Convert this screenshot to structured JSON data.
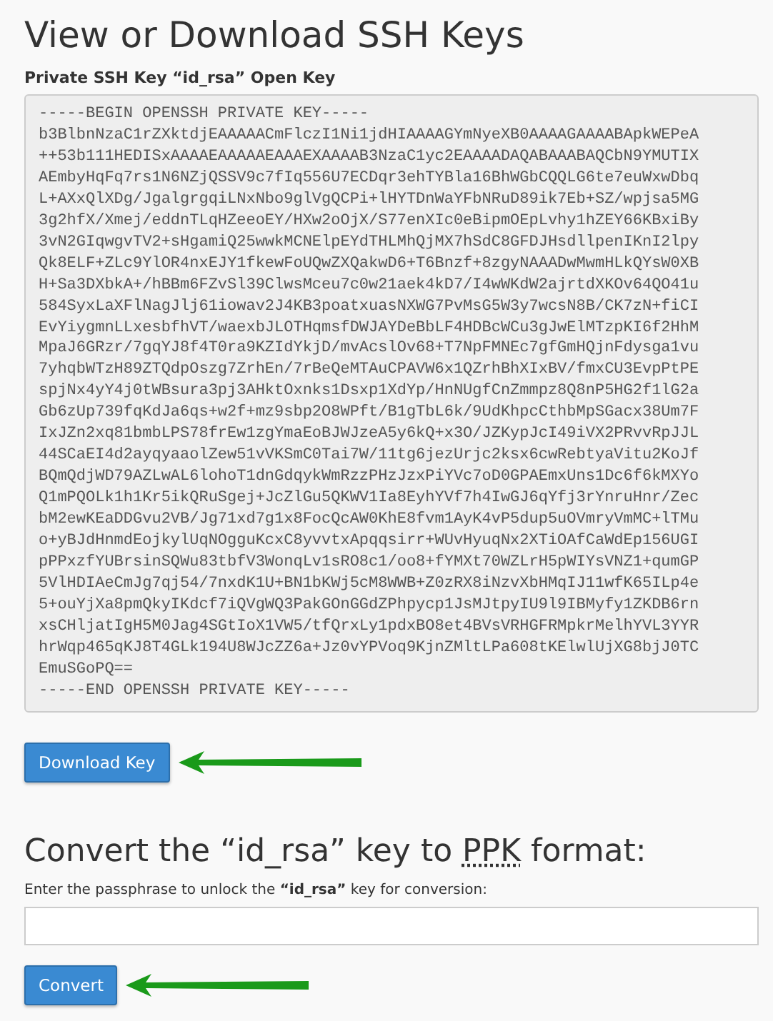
{
  "title": "View or Download SSH Keys",
  "key_label": "Private SSH Key “id_rsa” Open Key",
  "key_text": "-----BEGIN OPENSSH PRIVATE KEY-----\nb3BlbnNzaC1rZXktdjEAAAAACmFlczI1Ni1jdHIAAAAGYmNyeXB0AAAAGAAAABApkWEPeA\n++53b111HEDISxAAAAEAAAAAEAAAEXAAAAB3NzaC1yc2EAAAADAQABAAABAQCbN9YMUTIX\nAEmbyHqFq7rs1N6NZjQSSV9c7fIq556U7ECDqr3ehTYBla16BhWGbCQQLG6te7euWxwDbq\nL+AXxQlXDg/JgalgrgqiLNxNbo9glVgQCPi+lHYTDnWaYFbNRuD89ik7Eb+SZ/wpjsa5MG\n3g2hfX/Xmej/eddnTLqHZeeoEY/HXw2oOjX/S77enXIc0eBipmOEpLvhy1hZEY66KBxiBy\n3vN2GIqwgvTV2+sHgamiQ25wwkMCNElpEYdTHLMhQjMX7hSdC8GFDJHsdllpenIKnI2lpy\nQk8ELF+ZLc9YlOR4nxEJY1fkewFoUQwZXQakwD6+T6Bnzf+8zgyNAAADwMwmHLkQYsW0XB\nH+Sa3DXbkA+/hBBm6FZvSl39ClwsMceu7c0w21aek4kD7/I4wWKdW2ajrtdXKOv64QO41u\n584SyxLaXFlNagJlj61iowav2J4KB3poatxuasNXWG7PvMsG5W3y7wcsN8B/CK7zN+fiCI\nEvYiygmnLLxesbfhVT/waexbJLOTHqmsfDWJAYDeBbLF4HDBcWCu3gJwElMTzpKI6f2HhM\nMpaJ6GRzr/7gqYJ8f4T0ra9KZIdYkjD/mvAcslOv68+T7NpFMNEc7gfGmHQjnFdysga1vu\n7yhqbWTzH89ZTQdpOszg7ZrhEn/7rBeQeMTAuCPAVW6x1QZrhBhXIxBV/fmxCU3EvpPtPE\nspjNx4yY4j0tWBsura3pj3AHktOxnks1Dsxp1XdYp/HnNUgfCnZmmpz8Q8nP5HG2f1lG2a\nGb6zUp739fqKdJa6qs+w2f+mz9sbp2O8WPft/B1gTbL6k/9UdKhpcCthbMpSGacx38Um7F\nIxJZn2xq81bmbLPS78frEw1zgYmaEoBJWJzeA5y6kQ+x3O/JZKypJcI49iVX2PRvvRpJJL\n44SCaEI4d2ayqyaaolZew51vVKSmC0Tai7W/11tg6jezUrjc2ksx6cwRebtyaVitu2KoJf\nBQmQdjWD79AZLwAL6lohoT1dnGdqykWmRzzPHzJzxPiYVc7oD0GPAEmxUns1Dc6f6kMXYo\nQ1mPQOLk1h1Kr5ikQRuSgej+JcZlGu5QKWV1Ia8EyhYVf7h4IwGJ6qYfj3rYnruHnr/Zec\nbM2ewKEaDDGvu2VB/Jg71xd7g1x8FocQcAW0KhE8fvm1AyK4vP5dup5uOVmryVmMC+lTMu\no+yBJdHnmdEojkylUqNOgguKcxC8yvvtxApqqsirr+WUvHyuqNx2XTiOAfCaWdEp156UGI\npPPxzfYUBrsinSQWu83tbfV3WonqLv1sRO8c1/oo8+fYMXt70WZLrH5pWIYsVNZ1+qumGP\n5VlHDIAeCmJg7qj54/7nxdK1U+BN1bKWj5cM8WWB+Z0zRX8iNzvXbHMqIJ11wfK65ILp4e\n5+ouYjXa8pmQkyIKdcf7iQVgWQ3PakGOnGGdZPhpycp1JsMJtpyIU9l9IBMyfy1ZKDB6rn\nxsCHljatIgH5M0Jag4SGtIoX1VW5/tfQrxLy1pdxBO8et4BVsVRHGFRMpkrMelhYVL3YYR\nhrWqp465qKJ8T4GLk194U8WJcZZ6a+Jz0vYPVoq9KjnZMltLPa608tKElwlUjXG8bjJ0TC\nEmuSGoPQ==\n-----END OPENSSH PRIVATE KEY-----",
  "download_button": "Download Key",
  "convert_heading": {
    "before": "Convert the “id_rsa” key to ",
    "abbr": "PPK",
    "after": " format:"
  },
  "passphrase_label": "Enter the passphrase to unlock the **“id_rsa”** key for conversion:",
  "convert_button": "Convert"
}
